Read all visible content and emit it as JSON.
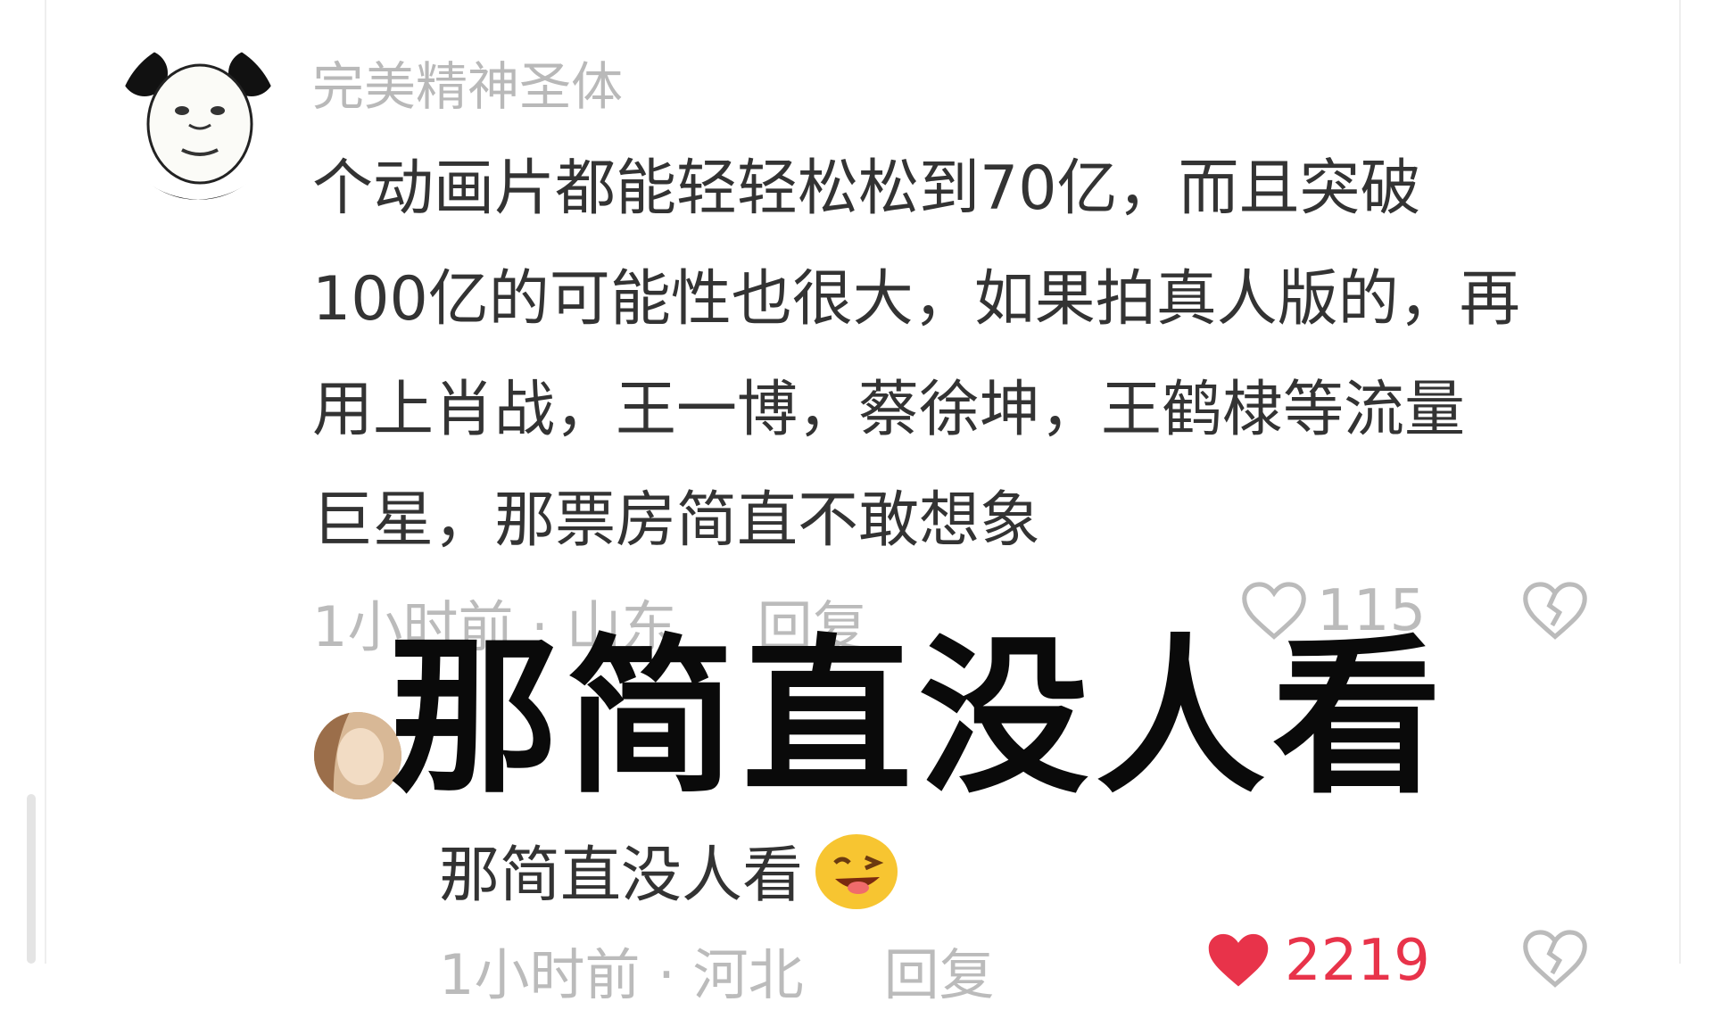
{
  "comment": {
    "username": "完美精神圣体",
    "lines": [
      "个动画片都能轻轻松松到70亿，而且突破",
      "100亿的可能性也很大，如果拍真人版的，再",
      "用上肖战，王一博，蔡徐坤，王鹤棣等流量",
      "巨星，那票房简直不敢想象"
    ],
    "time_location": "1小时前 · 山东",
    "reply_label": "回复",
    "like_count": "115",
    "icons": {
      "like": "heart-outline-icon",
      "dislike": "broken-heart-icon",
      "avatar": "panda-meme-avatar"
    }
  },
  "overlay_caption": "那简直没人看",
  "reply": {
    "username": "",
    "text": "那简直没人看",
    "emoji": "😜",
    "time_location": "1小时前 · 河北",
    "reply_label": "回复",
    "like_count": "2219",
    "like_color": "#e8334a",
    "icons": {
      "like": "heart-filled-icon",
      "dislike": "broken-heart-icon",
      "emoji": "wink-tongue-emoji-icon"
    }
  }
}
